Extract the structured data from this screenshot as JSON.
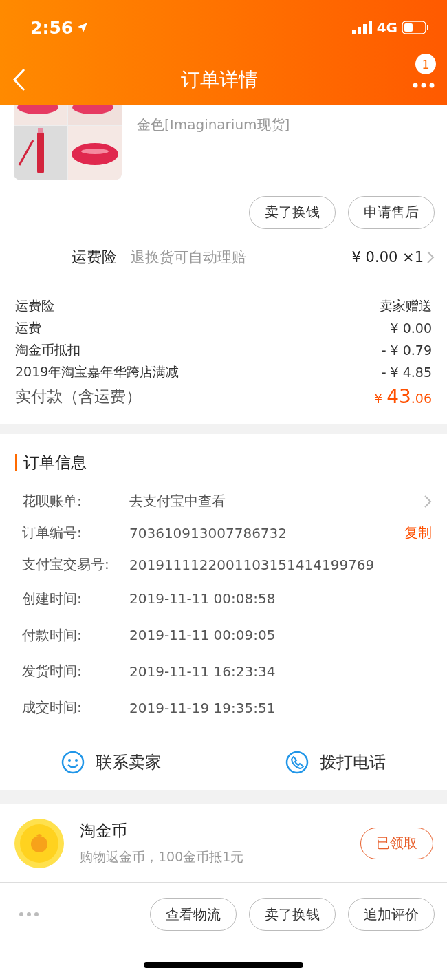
{
  "status_bar": {
    "time": "2:56",
    "network": "4G"
  },
  "nav": {
    "title": "订单详情",
    "badge": "1"
  },
  "product": {
    "kind": "picture",
    "sku": "金色[Imaginarium现货]",
    "actions": [
      "卖了换钱",
      "申请售后"
    ]
  },
  "insurance": {
    "label": "运费险",
    "desc": "退换货可自动理赔",
    "price": "¥ 0.00 ×1"
  },
  "fees": [
    {
      "label": "运费险",
      "value": "卖家赠送"
    },
    {
      "label": "运费",
      "value": "¥ 0.00"
    },
    {
      "label": "淘金币抵扣",
      "value": "- ¥ 0.79"
    },
    {
      "label": "2019年淘宝嘉年华跨店满减",
      "value": "- ¥ 4.85"
    }
  ],
  "total": {
    "label": "实付款（含运费）",
    "currency": "¥",
    "integer": "43",
    "decimal": ".06"
  },
  "order_info": {
    "title": "订单信息",
    "rows": [
      {
        "label": "花呗账单:",
        "value": "去支付宝中查看",
        "kind": "link"
      },
      {
        "label": "订单编号:",
        "value": "703610913007786732",
        "kind": "copy",
        "action": "复制"
      },
      {
        "label": "支付宝交易号:",
        "value": "2019111122001103151414199769",
        "kind": "plain"
      },
      {
        "label": "创建时间:",
        "value": "2019-11-11 00:08:58",
        "kind": "plain"
      },
      {
        "label": "付款时间:",
        "value": "2019-11-11 00:09:05",
        "kind": "plain"
      },
      {
        "label": "发货时间:",
        "value": "2019-11-11 16:23:34",
        "kind": "plain"
      },
      {
        "label": "成交时间:",
        "value": "2019-11-19 19:35:51",
        "kind": "plain"
      }
    ]
  },
  "contact": [
    {
      "label": "联系卖家",
      "kind": "chat"
    },
    {
      "label": "拨打电话",
      "kind": "phone"
    }
  ],
  "coins": {
    "title": "淘金币",
    "desc": "购物返金币，100金币抵1元",
    "button": "已领取"
  },
  "bottom_actions": [
    "查看物流",
    "卖了换钱",
    "追加评价"
  ]
}
